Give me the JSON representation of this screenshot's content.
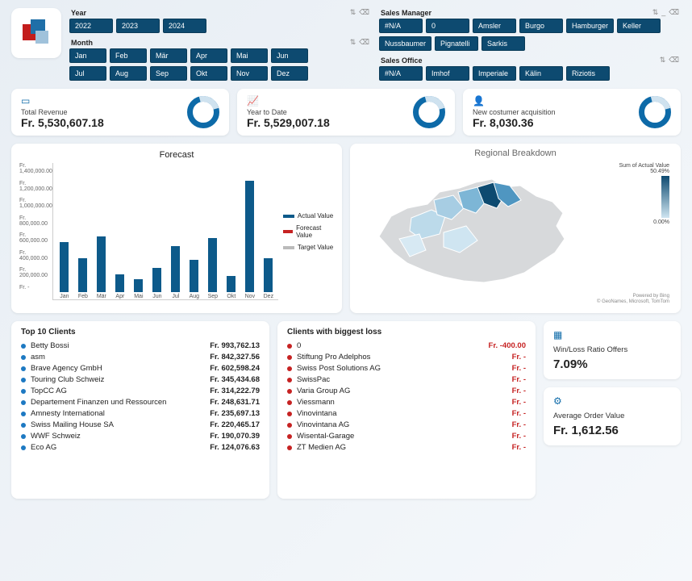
{
  "filters": {
    "year": {
      "title": "Year",
      "items": [
        "2022",
        "2023",
        "2024"
      ]
    },
    "month": {
      "title": "Month",
      "items": [
        "Jan",
        "Feb",
        "Mär",
        "Apr",
        "Mai",
        "Jun",
        "Jul",
        "Aug",
        "Sep",
        "Okt",
        "Nov",
        "Dez"
      ]
    },
    "manager": {
      "title": "Sales Manager",
      "items": [
        "#N/A",
        "0",
        "Amsler",
        "Burgo",
        "Hamburger",
        "Keller",
        "Nussbaumer",
        "Pignatelli",
        "Sarkis"
      ]
    },
    "office": {
      "title": "Sales Office",
      "items": [
        "#N/A",
        "Imhof",
        "Imperiale",
        "Kälin",
        "Riziotis"
      ]
    }
  },
  "kpi": {
    "revenue": {
      "label": "Total Revenue",
      "value": "Fr. 5,530,607.18"
    },
    "ytd": {
      "label": "Year to Date",
      "value": "Fr. 5,529,007.18"
    },
    "new_cust": {
      "label": "New costumer acquisition",
      "value": "Fr. 8,030.36"
    }
  },
  "forecast": {
    "title": "Forecast",
    "ylabels": [
      "Fr. 1,400,000.00",
      "Fr. 1,200,000.00",
      "Fr. 1,000,000.00",
      "Fr. 800,000.00",
      "Fr. 600,000.00",
      "Fr. 400,000.00",
      "Fr. 200,000.00",
      "Fr. -"
    ],
    "legend": {
      "actual": "Actual Value",
      "forecast": "Forecast Value",
      "target": "Target Value"
    }
  },
  "map": {
    "title": "Regional Breakdown",
    "scale_title": "Sum of Actual Value",
    "scale_max": "50.49%",
    "scale_min": "0.00%",
    "credit1": "Powered by Bing",
    "credit2": "© GeoNames, Microsoft, TomTom"
  },
  "top_clients": {
    "title": "Top 10 Clients",
    "rows": [
      {
        "name": "Betty Bossi",
        "value": "Fr. 993,762.13"
      },
      {
        "name": "asm",
        "value": "Fr. 842,327.56"
      },
      {
        "name": "Brave Agency GmbH",
        "value": "Fr. 602,598.24"
      },
      {
        "name": "Touring Club Schweiz",
        "value": "Fr. 345,434.68"
      },
      {
        "name": "TopCC AG",
        "value": "Fr. 314,222.79"
      },
      {
        "name": "Departement Finanzen und Ressourcen",
        "value": "Fr. 248,631.71"
      },
      {
        "name": "Amnesty International",
        "value": "Fr. 235,697.13"
      },
      {
        "name": "Swiss Mailing House SA",
        "value": "Fr. 220,465.17"
      },
      {
        "name": "WWF Schweiz",
        "value": "Fr. 190,070.39"
      },
      {
        "name": "Eco AG",
        "value": "Fr. 124,076.63"
      }
    ]
  },
  "loss_clients": {
    "title": "Clients with biggest loss",
    "rows": [
      {
        "name": "0",
        "value": "Fr. -400.00"
      },
      {
        "name": "Stiftung Pro Adelphos",
        "value": "Fr. -"
      },
      {
        "name": "Swiss Post Solutions AG",
        "value": "Fr. -"
      },
      {
        "name": "SwissPac",
        "value": "Fr. -"
      },
      {
        "name": "Varia Group AG",
        "value": "Fr. -"
      },
      {
        "name": "Viessmann",
        "value": "Fr. -"
      },
      {
        "name": "Vinovintana",
        "value": "Fr. -"
      },
      {
        "name": "Vinovintana AG",
        "value": "Fr. -"
      },
      {
        "name": "Wisental-Garage",
        "value": "Fr. -"
      },
      {
        "name": "ZT Medien AG",
        "value": "Fr. -"
      }
    ]
  },
  "winloss": {
    "label": "Win/Loss Ratio Offers",
    "value": "7.09%"
  },
  "aov": {
    "label": "Average Order Value",
    "value": "Fr. 1,612.56"
  },
  "chart_data": {
    "type": "bar",
    "title": "Forecast",
    "categories": [
      "Jan",
      "Feb",
      "Mär",
      "Apr",
      "Mai",
      "Jun",
      "Jul",
      "Aug",
      "Sep",
      "Okt",
      "Nov",
      "Dez"
    ],
    "series": [
      {
        "name": "Actual Value",
        "values": [
          580000,
          390000,
          640000,
          210000,
          150000,
          280000,
          530000,
          370000,
          630000,
          190000,
          1290000,
          390000
        ]
      }
    ],
    "other_series": [
      "Forecast Value",
      "Target Value"
    ],
    "ylabel": "",
    "xlabel": "",
    "ylim": [
      0,
      1400000
    ],
    "y_tick_format": "Fr. #,##0.00"
  }
}
